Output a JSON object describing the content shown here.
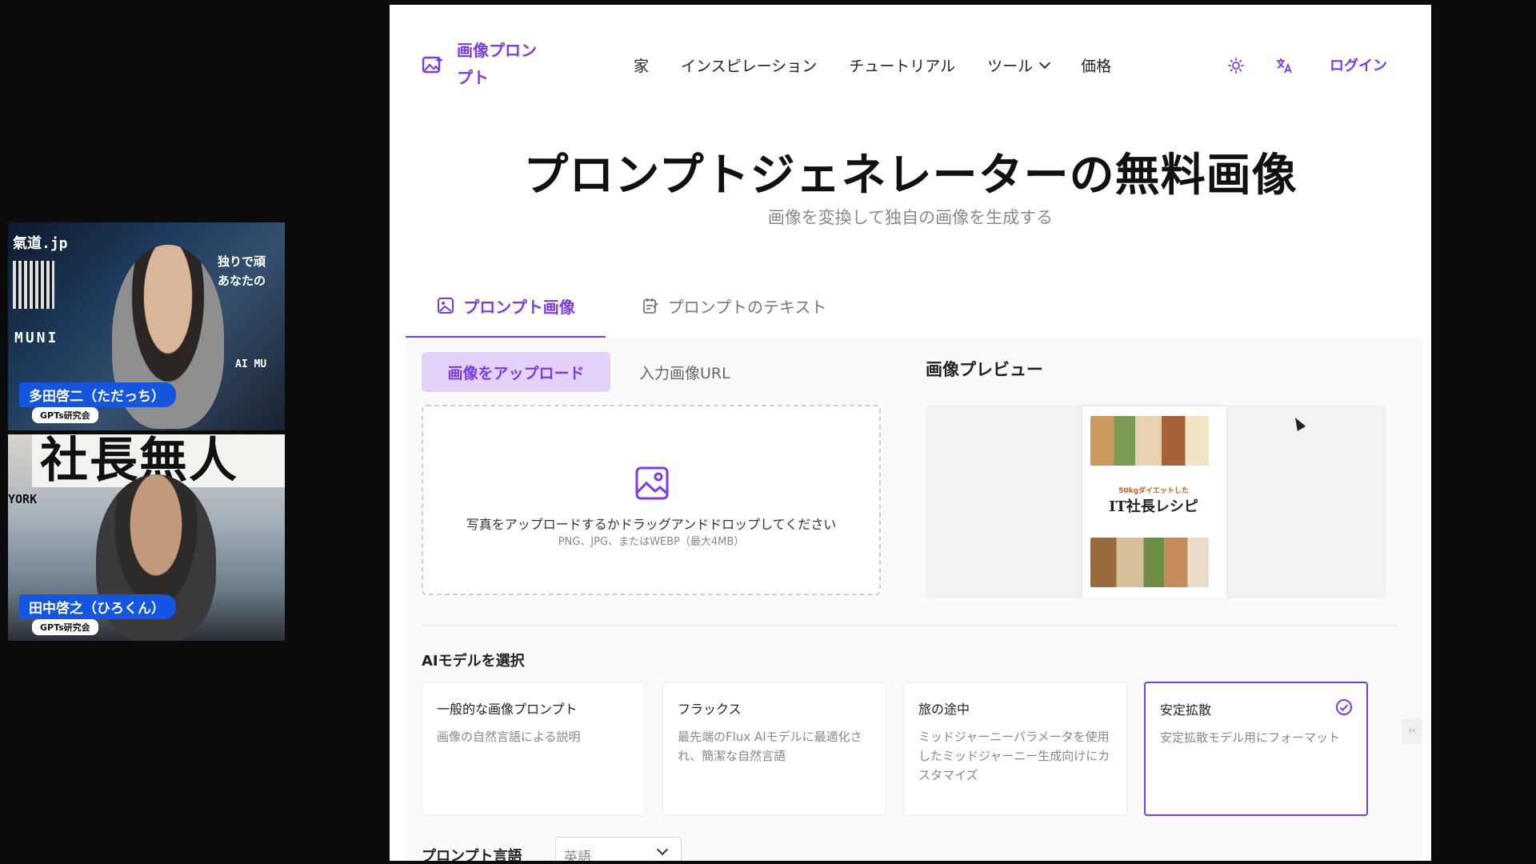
{
  "call": {
    "participants": [
      {
        "name": "多田啓二（ただっち）",
        "group": "GPTs研究会",
        "bg_texts": [
          "氣道.jp",
          "独りで頑",
          "あなたの",
          "MUNI",
          "AI MU"
        ]
      },
      {
        "name": "田中啓之（ひろくん）",
        "group": "GPTs研究会",
        "bg_texts": [
          "社長無人",
          "YORK"
        ]
      }
    ]
  },
  "nav": {
    "logo": "画像プロンプト",
    "links": [
      "家",
      "インスピレーション",
      "チュートリアル",
      "ツール",
      "価格"
    ],
    "login": "ログイン",
    "icons": [
      "sun-icon",
      "translate-icon"
    ]
  },
  "hero": {
    "title": "プロンプトジェネレーターの無料画像",
    "subtitle": "画像を変換して独自の画像を生成する"
  },
  "tabs": {
    "image": "プロンプト画像",
    "text": "プロンプトのテキスト"
  },
  "upload": {
    "tab_upload": "画像をアップロード",
    "tab_url": "入力画像URL",
    "drop_text": "写真をアップロードするかドラッグアンドドロップしてください",
    "drop_hint": "PNG、JPG、またはWEBP（最大4MB）"
  },
  "preview": {
    "title": "画像プレビュー",
    "image_top": "50kgダイエットした",
    "image_title": "IT社長レシピ"
  },
  "models": {
    "label": "AIモデルを選択",
    "items": [
      {
        "title": "一般的な画像プロンプト",
        "desc": "画像の自然言語による説明"
      },
      {
        "title": "フラックス",
        "desc": "最先端のFlux AIモデルに最適化され、簡潔な自然言語"
      },
      {
        "title": "旅の途中",
        "desc": "ミッドジャーニーパラメータを使用したミッドジャーニー生成向けにカスタマイズ"
      },
      {
        "title": "安定拡散",
        "desc": "安定拡散モデル用にフォーマット"
      }
    ],
    "selected_index": 3
  },
  "language": {
    "label": "プロンプト言語",
    "value": "英語"
  },
  "colors": {
    "accent": "#7c3aed",
    "accent_light": "#e3d3fb",
    "badge_blue": "#1556e0"
  }
}
